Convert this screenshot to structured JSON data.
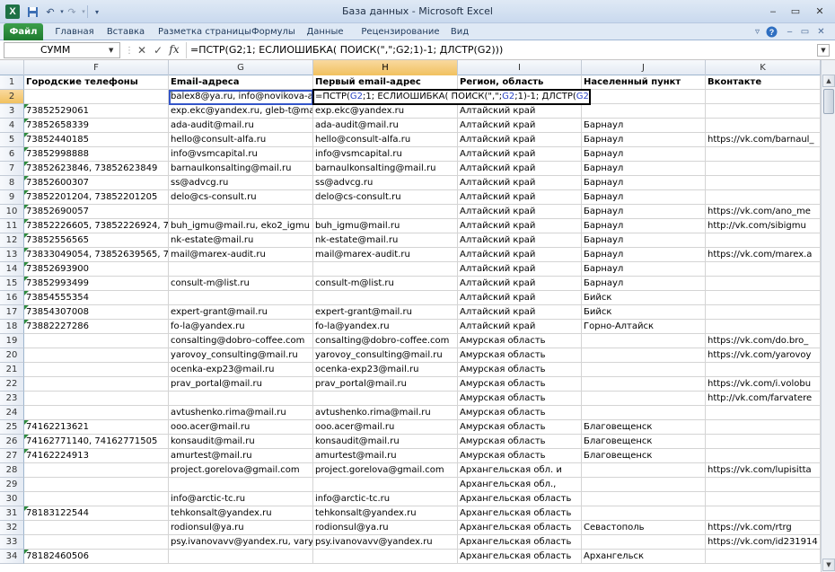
{
  "window": {
    "title": "База данных  -  Microsoft Excel",
    "app_icon_letter": "X"
  },
  "ribbon": {
    "file_label": "Файл",
    "tabs": [
      "Главная",
      "Вставка",
      "Разметка страницы",
      "Формулы",
      "Данные",
      "Рецензирование",
      "Вид"
    ]
  },
  "formula_bar": {
    "name_box": "СУММ",
    "formula": "=ПСТР(G2;1; ЕСЛИОШИБКА( ПОИСК(\",\";G2;1)-1; ДЛСТР(G2)))"
  },
  "columns": [
    {
      "letter": "F",
      "header": "Городские телефоны"
    },
    {
      "letter": "G",
      "header": "Email-адреса"
    },
    {
      "letter": "H",
      "header": "Первый email-адрес"
    },
    {
      "letter": "I",
      "header": "Регион, область"
    },
    {
      "letter": "J",
      "header": "Населенный пункт"
    },
    {
      "letter": "K",
      "header": "Вконтакте"
    }
  ],
  "selected_column": "H",
  "edit_cell": {
    "row": "2",
    "parts": [
      {
        "text": "=ПСТР(",
        "ref": false
      },
      {
        "text": "G2",
        "ref": true
      },
      {
        "text": ";1; ЕСЛИОШИБКА( ПОИСК(\",\";",
        "ref": false
      },
      {
        "text": "G2",
        "ref": true
      },
      {
        "text": ";1)-1; ДЛСТР(",
        "ref": false
      },
      {
        "text": "G2",
        "ref": true
      },
      {
        "text": ")))",
        "ref": false
      }
    ]
  },
  "rows": [
    {
      "n": "2",
      "F": "",
      "G": "balex8@ya.ru, info@novikova-a",
      "H": "",
      "I": "",
      "J": "",
      "K": "",
      "triF": false,
      "triG": true
    },
    {
      "n": "3",
      "F": "73852529061",
      "G": "exp.ekc@yandex.ru, gleb-t@ma",
      "H": "exp.ekc@yandex.ru",
      "I": "Алтайский край",
      "J": "",
      "K": "",
      "triF": true
    },
    {
      "n": "4",
      "F": "73852658339",
      "G": "ada-audit@mail.ru",
      "H": "ada-audit@mail.ru",
      "I": "Алтайский край",
      "J": "Барнаул",
      "K": "",
      "triF": true
    },
    {
      "n": "5",
      "F": "73852440185",
      "G": "hello@consult-alfa.ru",
      "H": "hello@consult-alfa.ru",
      "I": "Алтайский край",
      "J": "Барнаул",
      "K": "https://vk.com/barnaul_",
      "triF": true
    },
    {
      "n": "6",
      "F": "73852998888",
      "G": "info@vsmcapital.ru",
      "H": "info@vsmcapital.ru",
      "I": "Алтайский край",
      "J": "Барнаул",
      "K": "",
      "triF": true
    },
    {
      "n": "7",
      "F": "73852623846, 73852623849",
      "G": "barnaulkonsalting@mail.ru",
      "H": "barnaulkonsalting@mail.ru",
      "I": "Алтайский край",
      "J": "Барнаул",
      "K": "",
      "triF": true
    },
    {
      "n": "8",
      "F": "73852600307",
      "G": "ss@advcg.ru",
      "H": "ss@advcg.ru",
      "I": "Алтайский край",
      "J": "Барнаул",
      "K": "",
      "triF": true
    },
    {
      "n": "9",
      "F": "73852201204, 73852201205",
      "G": "delo@cs-consult.ru",
      "H": "delo@cs-consult.ru",
      "I": "Алтайский край",
      "J": "Барнаул",
      "K": "",
      "triF": true
    },
    {
      "n": "10",
      "F": "73852690057",
      "G": "",
      "H": "",
      "I": "Алтайский край",
      "J": "Барнаул",
      "K": "https://vk.com/ano_me",
      "triF": true
    },
    {
      "n": "11",
      "F": "73852226605, 73852226924, 7385",
      "G": "buh_igmu@mail.ru, eko2_igmu",
      "H": "buh_igmu@mail.ru",
      "I": "Алтайский край",
      "J": "Барнаул",
      "K": "http://vk.com/sibigmu",
      "triF": true
    },
    {
      "n": "12",
      "F": "73852556565",
      "G": "nk-estate@mail.ru",
      "H": "nk-estate@mail.ru",
      "I": "Алтайский край",
      "J": "Барнаул",
      "K": "",
      "triF": true
    },
    {
      "n": "13",
      "F": "73833049054, 73852639565, 7385",
      "G": "mail@marex-audit.ru",
      "H": "mail@marex-audit.ru",
      "I": "Алтайский край",
      "J": "Барнаул",
      "K": "https://vk.com/marex.a",
      "triF": true
    },
    {
      "n": "14",
      "F": "73852693900",
      "G": "",
      "H": "",
      "I": "Алтайский край",
      "J": "Барнаул",
      "K": "",
      "triF": true
    },
    {
      "n": "15",
      "F": "73852993499",
      "G": "consult-m@list.ru",
      "H": "consult-m@list.ru",
      "I": "Алтайский край",
      "J": "Барнаул",
      "K": "",
      "triF": true
    },
    {
      "n": "16",
      "F": "73854555354",
      "G": "",
      "H": "",
      "I": "Алтайский край",
      "J": "Бийск",
      "K": "",
      "triF": true
    },
    {
      "n": "17",
      "F": "73854307008",
      "G": "expert-grant@mail.ru",
      "H": "expert-grant@mail.ru",
      "I": "Алтайский край",
      "J": "Бийск",
      "K": "",
      "triF": true
    },
    {
      "n": "18",
      "F": "73882227286",
      "G": "fo-la@yandex.ru",
      "H": "fo-la@yandex.ru",
      "I": "Алтайский край",
      "J": "Горно-Алтайск",
      "K": "",
      "triF": true
    },
    {
      "n": "19",
      "F": "",
      "G": "consalting@dobro-coffee.com",
      "H": "consalting@dobro-coffee.com",
      "I": "Амурская область",
      "J": "",
      "K": "https://vk.com/do.bro_",
      "triF": false
    },
    {
      "n": "20",
      "F": "",
      "G": "yarovoy_consulting@mail.ru",
      "H": "yarovoy_consulting@mail.ru",
      "I": "Амурская область",
      "J": "",
      "K": "https://vk.com/yarovoy",
      "triF": false
    },
    {
      "n": "21",
      "F": "",
      "G": "ocenka-exp23@mail.ru",
      "H": "ocenka-exp23@mail.ru",
      "I": "Амурская область",
      "J": "",
      "K": "",
      "triF": false
    },
    {
      "n": "22",
      "F": "",
      "G": "prav_portal@mail.ru",
      "H": "prav_portal@mail.ru",
      "I": "Амурская область",
      "J": "",
      "K": "https://vk.com/i.volobu",
      "triF": false
    },
    {
      "n": "23",
      "F": "",
      "G": "",
      "H": "",
      "I": "Амурская область",
      "J": "",
      "K": "http://vk.com/farvatere",
      "triF": false
    },
    {
      "n": "24",
      "F": "",
      "G": "avtushenko.rima@mail.ru",
      "H": "avtushenko.rima@mail.ru",
      "I": "Амурская область",
      "J": "",
      "K": "",
      "triF": false
    },
    {
      "n": "25",
      "F": "74162213621",
      "G": "ooo.acer@mail.ru",
      "H": "ooo.acer@mail.ru",
      "I": "Амурская область",
      "J": "Благовещенск",
      "K": "",
      "triF": true
    },
    {
      "n": "26",
      "F": "74162771140, 74162771505",
      "G": "konsaudit@mail.ru",
      "H": "konsaudit@mail.ru",
      "I": "Амурская область",
      "J": "Благовещенск",
      "K": "",
      "triF": true
    },
    {
      "n": "27",
      "F": "74162224913",
      "G": "amurtest@mail.ru",
      "H": "amurtest@mail.ru",
      "I": "Амурская область",
      "J": "Благовещенск",
      "K": "",
      "triF": true
    },
    {
      "n": "28",
      "F": "",
      "G": "project.gorelova@gmail.com",
      "H": "project.gorelova@gmail.com",
      "I": "Архангельская обл. и",
      "J": "",
      "K": "https://vk.com/lupisitta",
      "triF": false
    },
    {
      "n": "29",
      "F": "",
      "G": "",
      "H": "",
      "I": "Архангельская обл.,",
      "J": "",
      "K": "",
      "triF": false
    },
    {
      "n": "30",
      "F": "",
      "G": "info@arctic-tc.ru",
      "H": "info@arctic-tc.ru",
      "I": "Архангельская область",
      "J": "",
      "K": "",
      "triF": false
    },
    {
      "n": "31",
      "F": "78183122544",
      "G": "tehkonsalt@yandex.ru",
      "H": "tehkonsalt@yandex.ru",
      "I": "Архангельская область",
      "J": "",
      "K": "",
      "triF": true
    },
    {
      "n": "32",
      "F": "",
      "G": "rodionsul@ya.ru",
      "H": "rodionsul@ya.ru",
      "I": "Архангельская область",
      "J": "Севастополь",
      "K": "https://vk.com/rtrg",
      "triF": false
    },
    {
      "n": "33",
      "F": "",
      "G": "psy.ivanovavv@yandex.ru, vary",
      "H": "psy.ivanovavv@yandex.ru",
      "I": "Архангельская область",
      "J": "",
      "K": "https://vk.com/id231914",
      "triF": false
    },
    {
      "n": "34",
      "F": "78182460506",
      "G": "",
      "H": "",
      "I": "Архангельская область",
      "J": "Архангельск",
      "K": "",
      "triF": true
    }
  ],
  "header_row_number": "1"
}
